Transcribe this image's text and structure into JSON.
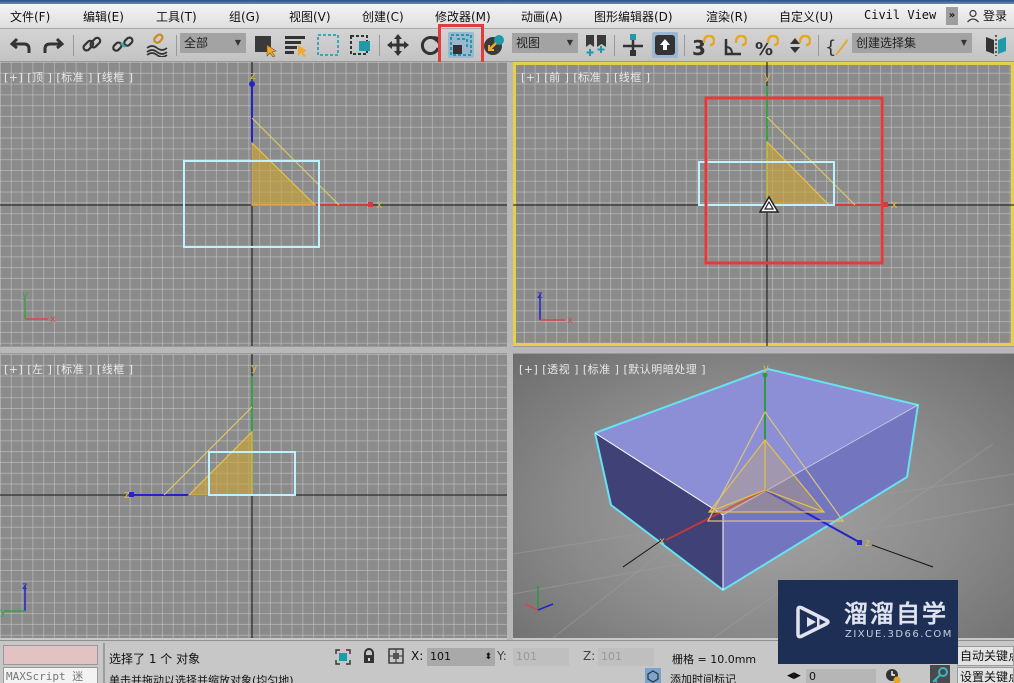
{
  "menu": {
    "items": [
      {
        "label": "文件(F)"
      },
      {
        "label": "编辑(E)"
      },
      {
        "label": "工具(T)"
      },
      {
        "label": "组(G)"
      },
      {
        "label": "视图(V)"
      },
      {
        "label": "创建(C)"
      },
      {
        "label": "修改器(M)"
      },
      {
        "label": "动画(A)"
      },
      {
        "label": "图形编辑器(D)"
      },
      {
        "label": "渲染(R)"
      },
      {
        "label": "自定义(U)"
      },
      {
        "label": "Civil View"
      }
    ],
    "more_label": "»",
    "login_label": "登录"
  },
  "toolbar": {
    "selection_filter": "全部",
    "reference_coord": "视图",
    "named_selection": "创建选择集",
    "highlighted_tool": "select-and-uniform-scale",
    "icons": [
      "undo-icon",
      "redo-icon",
      "link-icon",
      "unlink-icon",
      "bind-space-warp-icon",
      "select-object-icon",
      "select-by-name-icon",
      "rect-selection-icon",
      "window-crossing-icon",
      "move-icon",
      "rotate-icon",
      "scale-icon",
      "place-icon",
      "use-pivot-icon",
      "select-manipulate-icon",
      "keyboard-shortcut-icon",
      "snap-3d-icon",
      "angle-snap-icon",
      "percent-snap-icon",
      "spinner-snap-icon",
      "edit-named-selection-icon",
      "mirror-icon"
    ]
  },
  "viewports": {
    "top": {
      "label": "[+] [顶 ] [标准 ] [线框 ]",
      "axis_a": "z",
      "axis_b": "x",
      "tripod_a": "y",
      "tripod_b": "x"
    },
    "front": {
      "label": "[+] [前 ] [标准 ] [线框 ]",
      "axis_a": "y",
      "axis_b": "x",
      "tripod_a": "z",
      "tripod_b": "x",
      "active": true
    },
    "left": {
      "label": "[+] [左 ] [标准 ] [线框 ]",
      "axis_a": "y",
      "axis_b": "z",
      "tripod_a": "z",
      "tripod_b": "y"
    },
    "perspective": {
      "label": "[+] [透视 ] [标准 ] [默认明暗处理 ]",
      "axis_y": "y",
      "axis_x": "x",
      "axis_z": "z"
    }
  },
  "colors": {
    "selection_box": "#bff2ff",
    "highlight_red": "#e23b3b",
    "active_viewport": "#e8cf4a",
    "light_yellow": "#e4c24a",
    "box_fill": "#8c8fd6"
  },
  "status": {
    "maxscript_label": "MAXScript 迷",
    "selected_text": "选择了 1 个 对象",
    "prompt_text": "单击并拖动以选择并缩放对象(均匀地)",
    "x_label": "X:",
    "x_value": "101",
    "y_label": "Y:",
    "y_value": "101",
    "z_label": "Z:",
    "z_value": "101",
    "grid_text": "栅格 = 10.0mm",
    "add_time_tag": "添加时间标记",
    "frame_value": "0",
    "auto_key": "自动关键点",
    "set_key": "设置关键点"
  },
  "watermark": {
    "title": "溜溜自学",
    "subtitle": "ZIXUE.3D66.COM"
  }
}
